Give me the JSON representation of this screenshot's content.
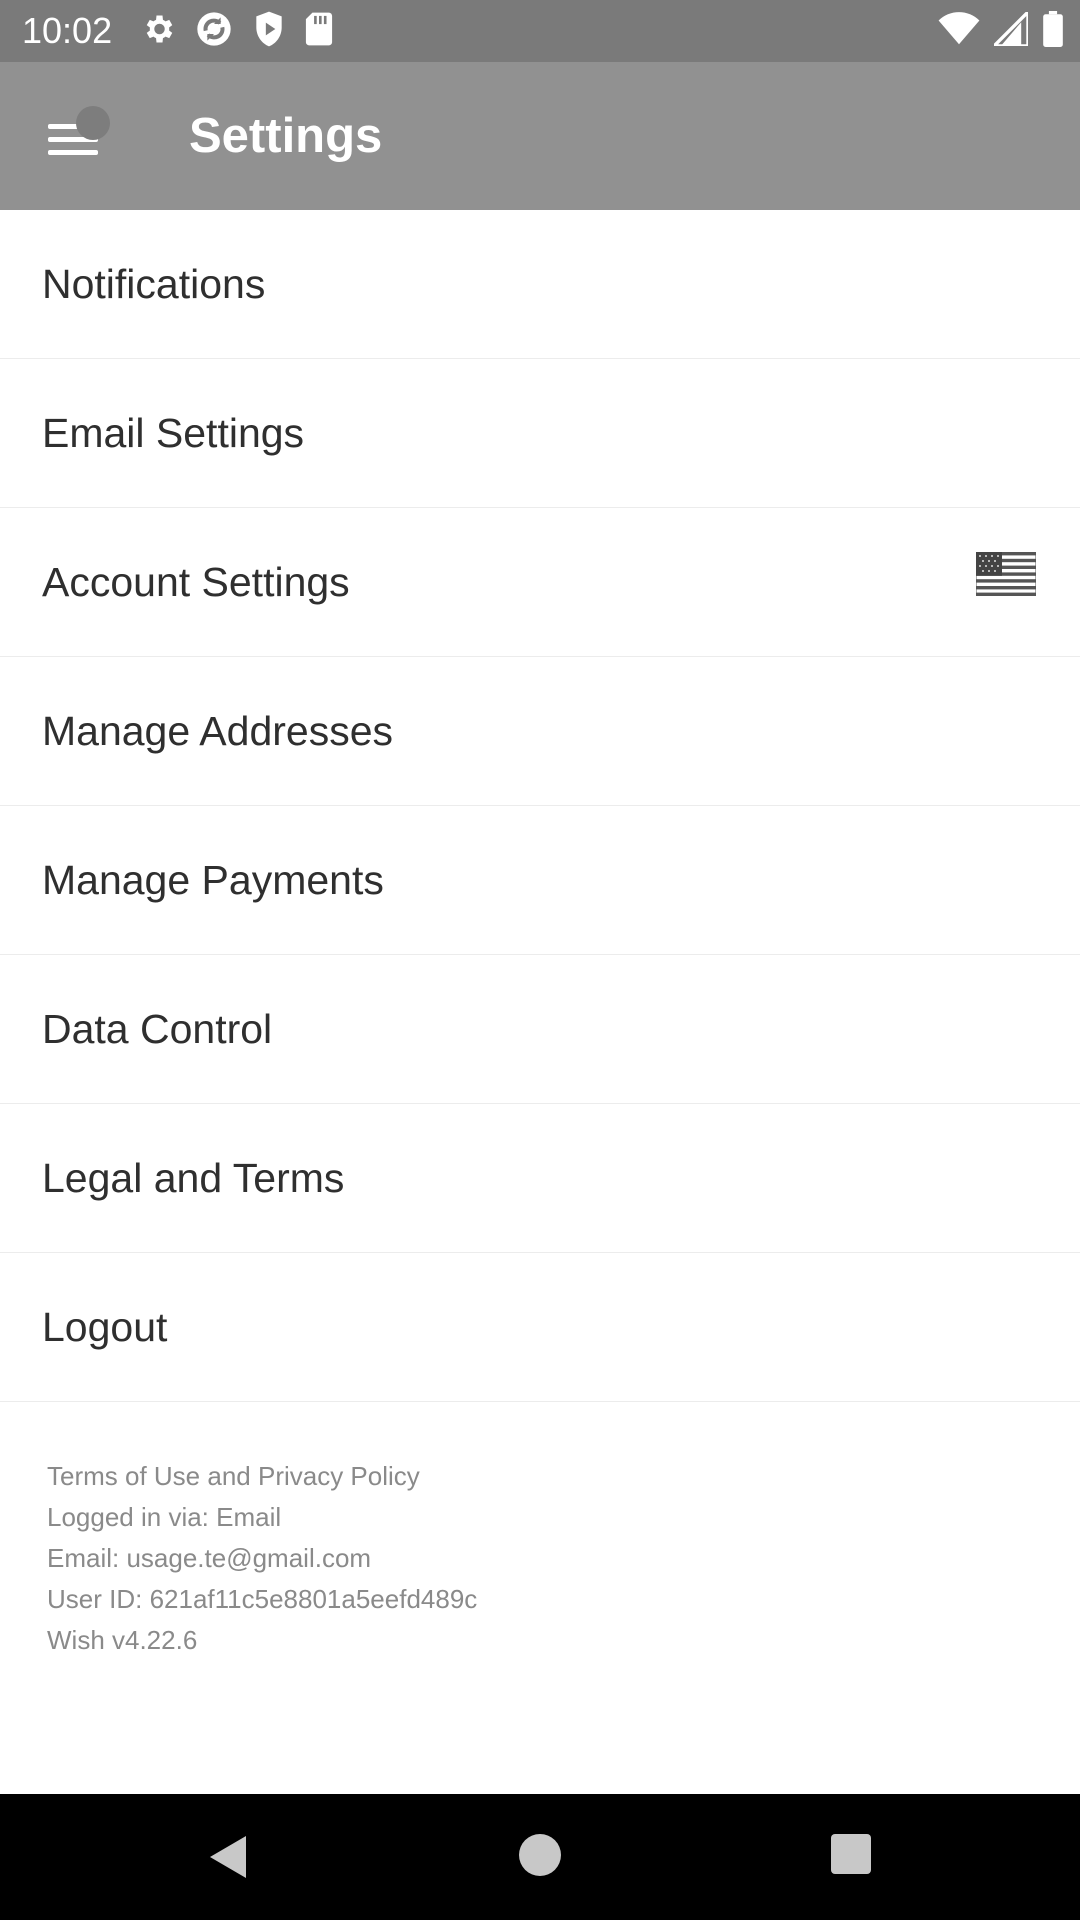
{
  "status_bar": {
    "time": "10:02",
    "left_icons": [
      "gear-icon",
      "sync-icon",
      "play-shield-icon",
      "sd-card-icon"
    ],
    "right_icons": [
      "wifi-icon",
      "signal-icon",
      "battery-icon"
    ]
  },
  "toolbar": {
    "title": "Settings",
    "menu_icon": "menu-icon"
  },
  "settings_items": [
    {
      "label": "Notifications"
    },
    {
      "label": "Email Settings"
    },
    {
      "label": "Account Settings",
      "trailing_icon": "us-flag-icon"
    },
    {
      "label": "Manage Addresses"
    },
    {
      "label": "Manage Payments"
    },
    {
      "label": "Data Control"
    },
    {
      "label": "Legal and Terms"
    },
    {
      "label": "Logout"
    }
  ],
  "footer": {
    "terms": "Terms of Use and Privacy Policy",
    "login_method": "Logged in via: Email",
    "email": "Email: usage.te@gmail.com",
    "user_id": "User ID: 621af11c5e8801a5eefd489c",
    "version": "Wish v4.22.6"
  },
  "nav_bar": {
    "back_icon": "back-icon",
    "home_icon": "home-icon",
    "recents_icon": "recents-icon"
  },
  "colors": {
    "status_bar": "#7a7a7a",
    "toolbar": "#919191",
    "divider": "#ececec",
    "item_text": "#2f2f2f",
    "footer_text": "#8a8a8a",
    "nav_bar": "#000000"
  }
}
